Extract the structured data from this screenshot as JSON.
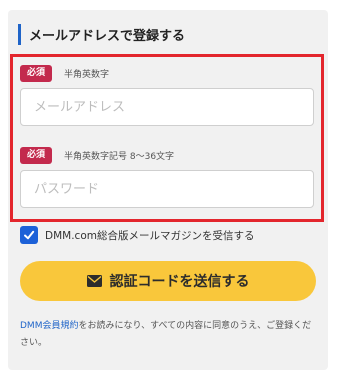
{
  "form": {
    "heading": "メールアドレスで登録する",
    "email": {
      "badge": "必須",
      "hint": "半角英数字",
      "placeholder": "メールアドレス",
      "value": ""
    },
    "password": {
      "badge": "必須",
      "hint": "半角英数字記号 8〜36文字",
      "placeholder": "パスワード",
      "value": ""
    },
    "newsletter": {
      "checked": true,
      "label": "DMM.com総合版メールマガジンを受信する"
    },
    "submit_label": "認証コードを送信する",
    "terms": {
      "link_text": "DMM会員規約",
      "text": "をお読みになり、すべての内容に同意のうえ、ご登録ください。"
    }
  },
  "colors": {
    "accent_blue": "#1f64c8",
    "required_badge": "#c32a4d",
    "highlight_border": "#e3262d",
    "submit_bg": "#f9c73b"
  },
  "icons": {
    "submit": "envelope-icon",
    "checkbox": "checkmark-icon"
  }
}
